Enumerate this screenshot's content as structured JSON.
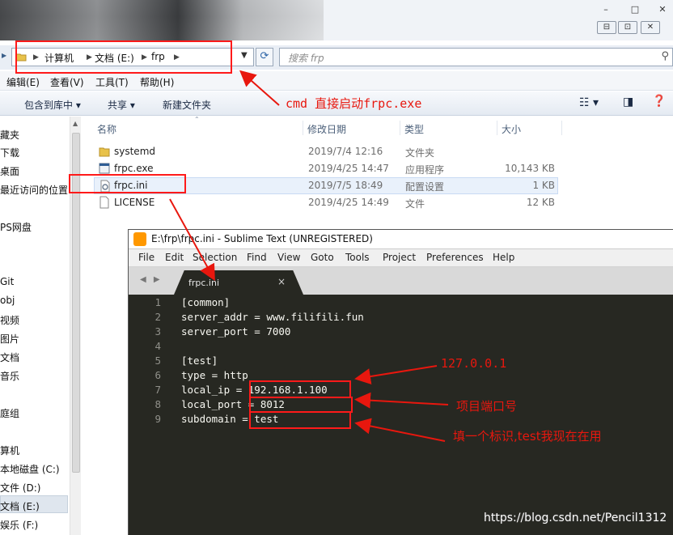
{
  "window": {
    "controls": {
      "minimize": "–",
      "maximize": "□",
      "close": "✕",
      "sub_min": "⊟",
      "sub_restore": "⊡",
      "sub_close": "✕"
    }
  },
  "address": {
    "crumbs": [
      "计算机",
      "文档 (E:)",
      "frp"
    ],
    "search_placeholder": "搜索 frp"
  },
  "menu": [
    "编辑(E)",
    "查看(V)",
    "工具(T)",
    "帮助(H)"
  ],
  "toolbar": {
    "include_library": "包含到库中",
    "share": "共享",
    "new_folder": "新建文件夹"
  },
  "nav": {
    "items": [
      "藏夹",
      "下载",
      "桌面",
      "最近访问的位置",
      "PS网盘",
      "Git",
      "obj",
      "视频",
      "图片",
      "文档",
      "音乐",
      "庭组",
      "算机",
      "本地磁盘 (C:)",
      "文件 (D:)",
      "文档 (E:)",
      "娱乐 (F:)"
    ]
  },
  "columns": {
    "name": "名称",
    "modified": "修改日期",
    "type": "类型",
    "size": "大小"
  },
  "files": [
    {
      "name": "systemd",
      "modified": "2019/7/4 12:16",
      "type": "文件夹",
      "size": "",
      "icon": "folder-icon"
    },
    {
      "name": "frpc.exe",
      "modified": "2019/4/25 14:47",
      "type": "应用程序",
      "size": "10,143 KB",
      "icon": "exe-icon"
    },
    {
      "name": "frpc.ini",
      "modified": "2019/7/5 18:49",
      "type": "配置设置",
      "size": "1 KB",
      "icon": "ini-icon"
    },
    {
      "name": "LICENSE",
      "modified": "2019/4/25 14:49",
      "type": "文件",
      "size": "12 KB",
      "icon": "file-icon"
    }
  ],
  "sublime": {
    "title": "E:\\frp\\frpc.ini - Sublime Text (UNREGISTERED)",
    "menu": [
      "File",
      "Edit",
      "Selection",
      "Find",
      "View",
      "Goto",
      "Tools",
      "Project",
      "Preferences",
      "Help"
    ],
    "tab_nav": "◀ ▶",
    "tab_title": "frpc.ini",
    "tab_close": "×",
    "line_numbers": [
      "1",
      "2",
      "3",
      "4",
      "5",
      "6",
      "7",
      "8",
      "9"
    ],
    "lines": [
      "[common]",
      "server_addr = www.filifili.fun",
      "server_port = 7000",
      "",
      "[test]",
      "type = http",
      "local_ip = 192.168.1.100",
      "local_port = 8012",
      "subdomain = test"
    ]
  },
  "annotations": {
    "cmd": "cmd 直接启动frpc.exe",
    "local_ip": "127.0.0.1",
    "local_port": "项目端口号",
    "subdomain": "填一个标识,test我现在在用",
    "color": "#e8170e"
  },
  "watermark": "https://blog.csdn.net/Pencil1312"
}
